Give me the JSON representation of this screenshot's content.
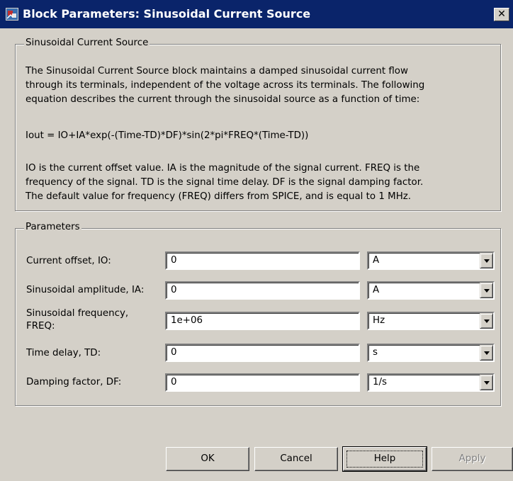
{
  "window": {
    "title": "Block Parameters: Sinusoidal Current Source",
    "close_label": "✕"
  },
  "description_group": {
    "legend": "Sinusoidal Current Source",
    "paragraph1": "The Sinusoidal Current Source block maintains a damped sinusoidal current flow\nthrough its terminals, independent of the voltage across its terminals. The following\nequation describes the current through the sinusoidal source as a function of time:",
    "equation": "Iout = IO+IA*exp(-(Time-TD)*DF)*sin(2*pi*FREQ*(Time-TD))",
    "paragraph2": "IO is the current offset value. IA is the magnitude of the signal current. FREQ is the\nfrequency of the signal. TD is the signal time delay. DF is the signal damping factor.\nThe default value for frequency (FREQ) differs from SPICE, and is equal to 1 MHz."
  },
  "parameters_group": {
    "legend": "Parameters",
    "rows": [
      {
        "label": "Current offset, IO:",
        "value": "0",
        "unit": "A"
      },
      {
        "label": "Sinusoidal amplitude, IA:",
        "value": "0",
        "unit": "A"
      },
      {
        "label": "Sinusoidal frequency,\nFREQ:",
        "value": "1e+06",
        "unit": "Hz"
      },
      {
        "label": "Time delay, TD:",
        "value": "0",
        "unit": "s"
      },
      {
        "label": "Damping factor, DF:",
        "value": "0",
        "unit": "1/s"
      }
    ]
  },
  "buttons": {
    "ok": "OK",
    "cancel": "Cancel",
    "help": "Help",
    "apply": "Apply"
  },
  "colors": {
    "titlebar": "#0a246a",
    "dialog_bg": "#d4d0c8"
  }
}
